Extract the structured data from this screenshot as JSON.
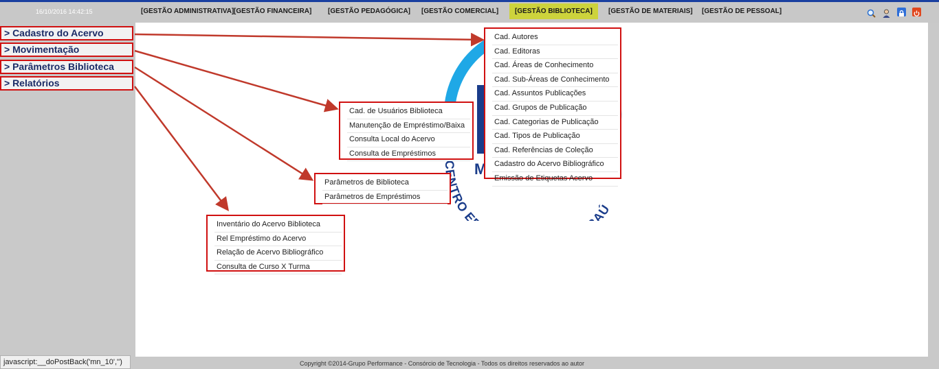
{
  "header": {
    "datetime": "16/10/2016 14:42:15",
    "nav": [
      {
        "label": "[GESTÃO ADMINISTRATIVA]"
      },
      {
        "label": "[GESTÃO FINANCEIRA]"
      },
      {
        "label": "[GESTÃO PEDAGÓGICA]"
      },
      {
        "label": "[GESTÃO COMERCIAL]"
      },
      {
        "label": "[GESTÃO BIBLIOTECA]",
        "active": true
      },
      {
        "label": "[GESTÃO DE MATERIAIS]"
      },
      {
        "label": "[GESTÃO DE PESSOAL]"
      }
    ],
    "icons": [
      "search-icon",
      "user-icon",
      "lock-icon",
      "power-icon"
    ],
    "active_color": "#cdd33c"
  },
  "sidebar": {
    "items": [
      {
        "label": "> Cadastro do Acervo"
      },
      {
        "label": "> Movimentação"
      },
      {
        "label": "> Parâmetros Biblioteca"
      },
      {
        "label": "> Relatórios"
      }
    ]
  },
  "menus": {
    "cadastro": [
      "Cad. Autores",
      "Cad. Editoras",
      "Cad. Áreas de Conhecimento",
      "Cad. Sub-Áreas de Conhecimento",
      "Cad. Assuntos Publicações",
      "Cad. Grupos de Publicação",
      "Cad. Categorias de Publicação",
      "Cad. Tipos de Publicação",
      "Cad. Referências de Coleção",
      "Cadastro do Acervo Bibliográfico",
      "Emissão de Etiquetas Acervo"
    ],
    "movimentacao": [
      "Cad. de Usuários Biblioteca",
      "Manutenção de Empréstimo/Baixa",
      "Consulta Local do Acervo",
      "Consulta de Empréstimos"
    ],
    "parametros": [
      "Parâmetros de Biblioteca",
      "Parâmetros de Empréstimos"
    ],
    "relatorios": [
      "Inventário do Acervo Biblioteca",
      "Rel Empréstimo do Acervo",
      "Relação de Acervo Bibliográfico",
      "Consulta de Curso X Turma"
    ]
  },
  "logo": {
    "arc_text": "CENTRO EDUCACIONAL DE PARAÚ",
    "mark_text": "M",
    "color": "#1fa8e6"
  },
  "footer": {
    "copyright": "Copyright ©2014-Grupo Performance - Consórcio de Tecnologia - Todos os direitos reservados ao autor",
    "status": "javascript:__doPostBack('mn_10','')"
  },
  "colors": {
    "highlight_border": "#d01010",
    "arrow": "#c0392b",
    "nav_active": "#cdd33c"
  }
}
